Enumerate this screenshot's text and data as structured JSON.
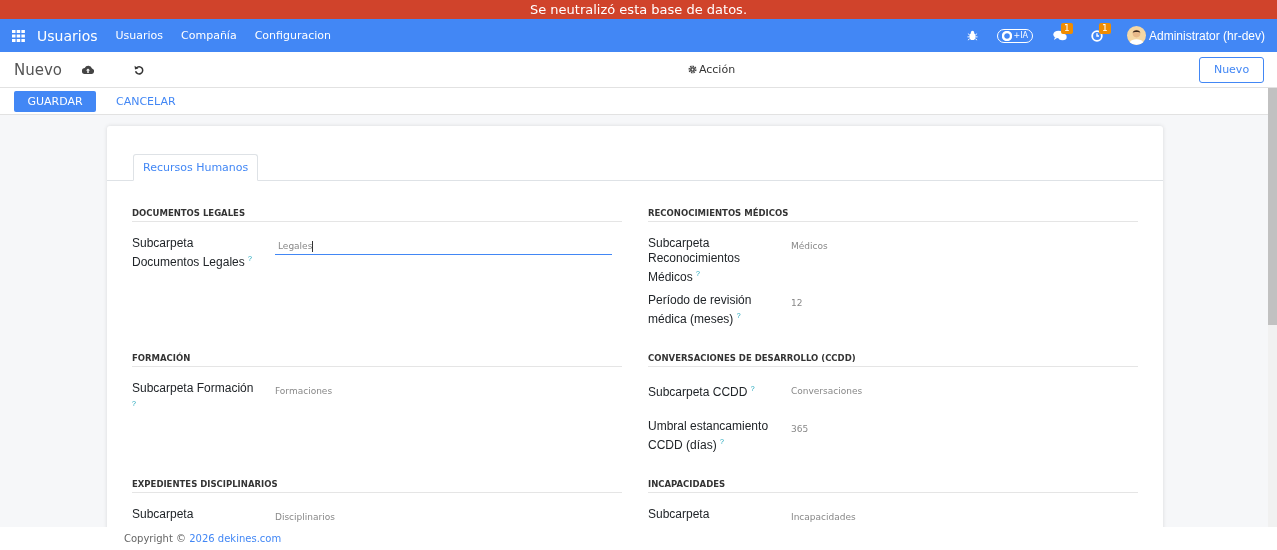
{
  "banner": "Se neutralizó esta base de datos.",
  "navbar": {
    "app_name": "Usuarios",
    "menu": [
      "Usuarios",
      "Compañía",
      "Configuracion"
    ],
    "ia_label": "+IA",
    "chat_badge": "1",
    "activity_badge": "1",
    "user": "Administrator (hr-dev)"
  },
  "control_panel": {
    "breadcrumb": "Nuevo",
    "action": "Acción",
    "new_button": "Nuevo"
  },
  "buttons": {
    "save": "GUARDAR",
    "cancel": "CANCELAR"
  },
  "tabs": [
    {
      "label": "Recursos Humanos",
      "selected": true
    }
  ],
  "sections": [
    {
      "title": "DOCUMENTOS LEGALES",
      "fields": [
        {
          "label": "Subcarpeta Documentos Legales $^{?}$",
          "placeholder": "Legales",
          "focused": true
        }
      ]
    },
    {
      "title": "RECONOCIMIENTOS MÉDICOS",
      "fields": [
        {
          "label": "Subcarpeta Reconocimientos Médicos $^{?}$",
          "placeholder": "Médicos",
          "focused": false
        },
        {
          "label": "Período de revisión médica (meses) $^{?}$",
          "placeholder": "12",
          "focused": false
        }
      ]
    },
    {
      "title": "FORMACIÓN",
      "fields": [
        {
          "label": "Subcarpeta Formación $^{?}$",
          "placeholder": "Formaciones",
          "focused": false
        }
      ]
    },
    {
      "title": "CONVERSACIONES DE DESARROLLO (CCDD)",
      "fields": [
        {
          "label": "Subcarpeta CCDD $^{?}$",
          "placeholder": "Conversaciones",
          "focused": false
        },
        {
          "label": "Umbral estancamiento CCDD (días) $^{?}$",
          "placeholder": "365",
          "focused": false
        }
      ]
    },
    {
      "title": "EXPEDIENTES DISCIPLINARIOS",
      "fields": [
        {
          "label": "Subcarpeta",
          "placeholder": "Disciplinarios",
          "focused": false
        }
      ]
    },
    {
      "title": "INCAPACIDADES",
      "fields": [
        {
          "label": "Subcarpeta",
          "placeholder": "Incapacidades",
          "focused": false
        }
      ]
    }
  ],
  "footer": {
    "text": "Copyright © ",
    "link": "2026 dekines.com"
  }
}
